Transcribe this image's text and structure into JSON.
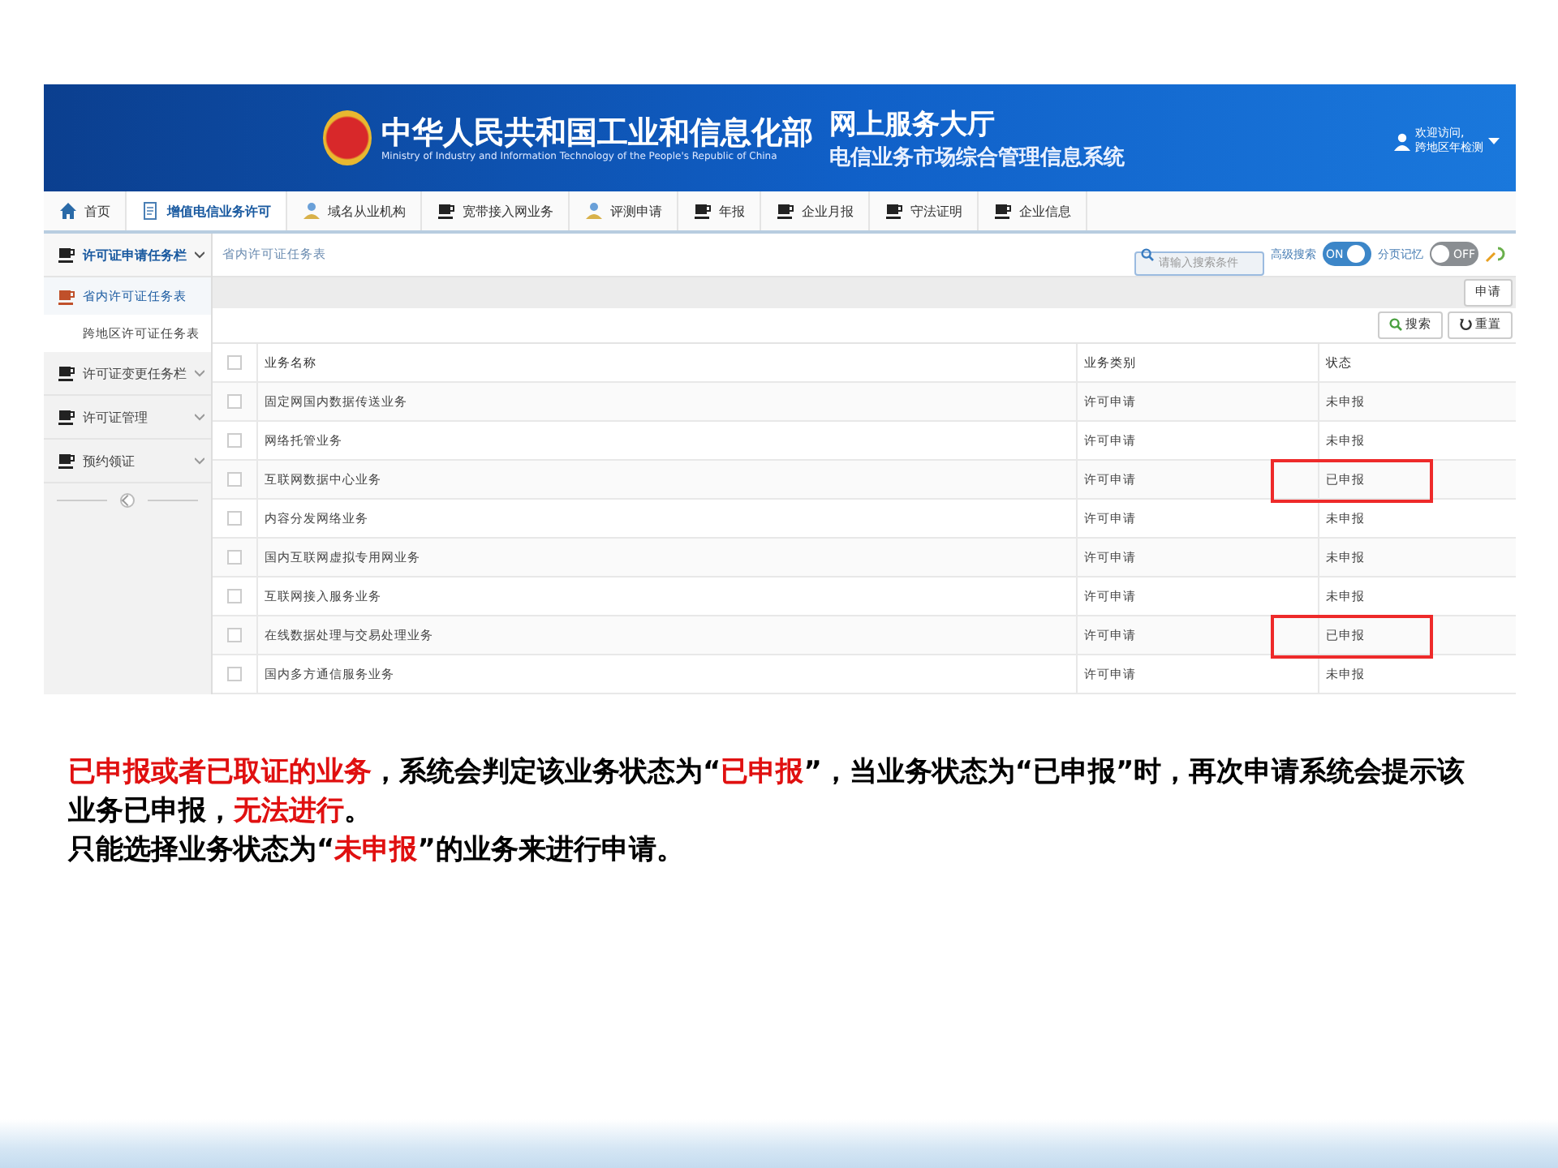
{
  "header": {
    "title": "中华人民共和国工业和信息化部",
    "subtitle_en": "Ministry of Industry and Information Technology of the People's Republic of China",
    "service_title": "网上服务大厅",
    "system_title": "电信业务市场综合管理信息系统",
    "user_greeting": "欢迎访问,",
    "user_name": "跨地区年检测"
  },
  "nav": [
    {
      "label": "首页",
      "selected": false
    },
    {
      "label": "增值电信业务许可",
      "selected": true
    },
    {
      "label": "域名从业机构",
      "selected": false
    },
    {
      "label": "宽带接入网业务",
      "selected": false
    },
    {
      "label": "评测申请",
      "selected": false
    },
    {
      "label": "年报",
      "selected": false
    },
    {
      "label": "企业月报",
      "selected": false
    },
    {
      "label": "守法证明",
      "selected": false
    },
    {
      "label": "企业信息",
      "selected": false
    }
  ],
  "sidebar": {
    "items": [
      {
        "label": "许可证申请任务栏",
        "expanded": true,
        "children": [
          {
            "label": "省内许可证任务表",
            "selected": true
          },
          {
            "label": "跨地区许可证任务表",
            "selected": false
          }
        ]
      },
      {
        "label": "许可证变更任务栏",
        "expanded": false
      },
      {
        "label": "许可证管理",
        "expanded": false
      },
      {
        "label": "预约领证",
        "expanded": false
      }
    ]
  },
  "breadcrumb": "省内许可证任务表",
  "search": {
    "placeholder": "请输入搜索条件"
  },
  "toggles": [
    {
      "label": "高级搜索",
      "on": true,
      "text": "ON"
    },
    {
      "label": "分页记忆",
      "on": false,
      "text": "OFF"
    }
  ],
  "apply_button": "申请",
  "search_button": "搜索",
  "reset_button": "重置",
  "table": {
    "select_all_checked": false,
    "columns": [
      "业务名称",
      "业务类别",
      "状态"
    ],
    "rows": [
      {
        "cells": [
          "固定网国内数据传送业务",
          "许可申请",
          "未申报"
        ],
        "checked": false,
        "highlighted": false
      },
      {
        "cells": [
          "网络托管业务",
          "许可申请",
          "未申报"
        ],
        "checked": false,
        "highlighted": false
      },
      {
        "cells": [
          "互联网数据中心业务",
          "许可申请",
          "已申报"
        ],
        "checked": false,
        "highlighted": true
      },
      {
        "cells": [
          "内容分发网络业务",
          "许可申请",
          "未申报"
        ],
        "checked": false,
        "highlighted": false
      },
      {
        "cells": [
          "国内互联网虚拟专用网业务",
          "许可申请",
          "未申报"
        ],
        "checked": false,
        "highlighted": false
      },
      {
        "cells": [
          "互联网接入服务业务",
          "许可申请",
          "未申报"
        ],
        "checked": false,
        "highlighted": false
      },
      {
        "cells": [
          "在线数据处理与交易处理业务",
          "许可申请",
          "已申报"
        ],
        "checked": false,
        "highlighted": true
      },
      {
        "cells": [
          "国内多方通信服务业务",
          "许可申请",
          "未申报"
        ],
        "checked": false,
        "highlighted": false
      }
    ]
  },
  "caption": [
    "*已申报或者已取证的业务*，系统会判定该业务状态为“*已申报*”，当业务状态为“已申报”时，再次申请系统会提示该业务已申报，*无法进行*。",
    "只能选择业务状态为“*未申报*”的业务来进行申请。"
  ]
}
